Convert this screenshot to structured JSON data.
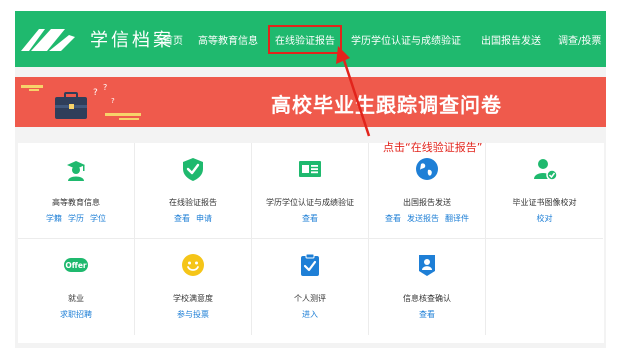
{
  "header": {
    "brand": "学信档案",
    "nav": [
      "首页",
      "高等教育信息",
      "在线验证报告",
      "学历学位认证与成绩验证",
      "出国报告发送",
      "调查/投票"
    ]
  },
  "banner": {
    "title": "高校毕业生跟踪调查问卷"
  },
  "annotation": {
    "hint": "点击“在线验证报告”"
  },
  "cards": [
    {
      "title": "高等教育信息",
      "icon": "graduate-icon",
      "links": [
        "学籍",
        "学历",
        "学位"
      ]
    },
    {
      "title": "在线验证报告",
      "icon": "shield-check-icon",
      "links": [
        "查看",
        "申请"
      ]
    },
    {
      "title": "学历学位认证与成绩验证",
      "icon": "certificate-icon",
      "links": [
        "查看"
      ]
    },
    {
      "title": "出国报告发送",
      "icon": "globe-icon",
      "links": [
        "查看",
        "发送报告",
        "翻译件"
      ]
    },
    {
      "title": "毕业证书图像校对",
      "icon": "user-check-icon",
      "links": [
        "校对"
      ]
    },
    {
      "title": "就业",
      "icon": "offer-icon",
      "links": [
        "求职招聘"
      ]
    },
    {
      "title": "学校满意度",
      "icon": "smiley-icon",
      "links": [
        "参与投票"
      ]
    },
    {
      "title": "个人测评",
      "icon": "clipboard-check-icon",
      "links": [
        "进入"
      ]
    },
    {
      "title": "信息核查确认",
      "icon": "id-badge-icon",
      "links": [
        "查看"
      ]
    }
  ],
  "colors": {
    "nav": "#1fb96e",
    "banner": "#ef5a4c",
    "link": "#1e7fd6",
    "highlight": "#e2241c",
    "green": "#1fb96e",
    "blue": "#1e7fd6",
    "yellow": "#f5c518"
  }
}
